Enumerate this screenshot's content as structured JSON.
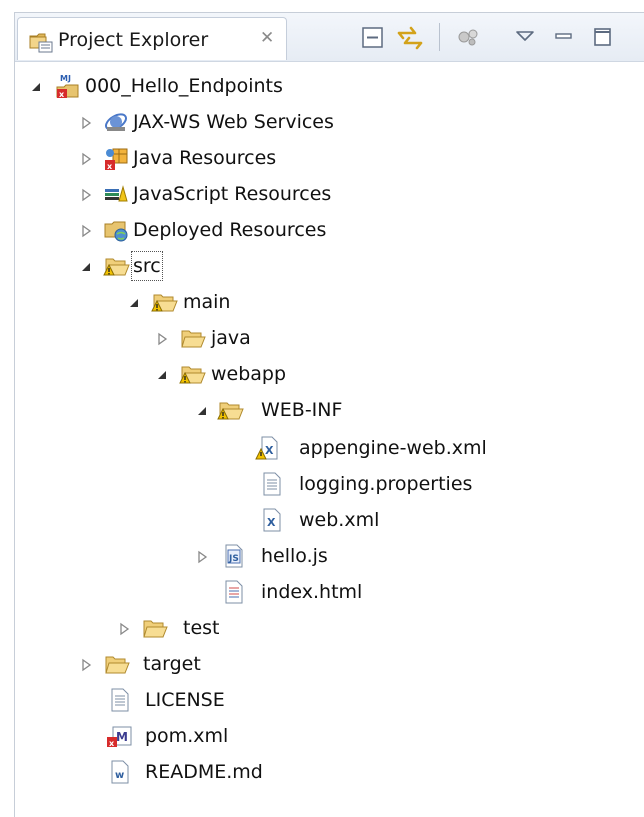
{
  "view": {
    "title": "Project Explorer",
    "close_glyph": "✕"
  },
  "toolbar": {
    "buttons": [
      "collapse-all-icon",
      "link-with-editor-icon",
      "filters-icon",
      "view-menu-icon",
      "minimize-icon",
      "maximize-icon"
    ]
  },
  "tree": {
    "items": [
      {
        "label": "000_Hello_Endpoints",
        "icon": "maven-project-icon",
        "state": "expanded"
      },
      {
        "label": "JAX-WS Web Services",
        "icon": "web-services-icon",
        "state": "collapsed"
      },
      {
        "label": "Java Resources",
        "icon": "java-resources-icon",
        "state": "collapsed"
      },
      {
        "label": "JavaScript Resources",
        "icon": "javascript-resources-icon",
        "state": "collapsed"
      },
      {
        "label": "Deployed Resources",
        "icon": "deployed-resources-icon",
        "state": "collapsed"
      },
      {
        "label": "src",
        "icon": "folder-warning-icon",
        "state": "expanded",
        "focused": true
      },
      {
        "label": "main",
        "icon": "folder-warning-icon",
        "state": "expanded"
      },
      {
        "label": "java",
        "icon": "folder-icon",
        "state": "collapsed"
      },
      {
        "label": "webapp",
        "icon": "folder-warning-icon",
        "state": "expanded"
      },
      {
        "label": "WEB-INF",
        "icon": "folder-warning-icon",
        "state": "expanded"
      },
      {
        "label": "appengine-web.xml",
        "icon": "xml-file-warning-icon",
        "state": "leaf"
      },
      {
        "label": "logging.properties",
        "icon": "text-file-icon",
        "state": "leaf"
      },
      {
        "label": "web.xml",
        "icon": "xml-file-icon",
        "state": "leaf"
      },
      {
        "label": "hello.js",
        "icon": "js-file-icon",
        "state": "collapsed"
      },
      {
        "label": "index.html",
        "icon": "html-file-icon",
        "state": "leaf"
      },
      {
        "label": "test",
        "icon": "folder-icon",
        "state": "collapsed"
      },
      {
        "label": "target",
        "icon": "folder-icon",
        "state": "collapsed"
      },
      {
        "label": "LICENSE",
        "icon": "text-file-icon",
        "state": "leaf"
      },
      {
        "label": "pom.xml",
        "icon": "maven-pom-icon",
        "state": "leaf"
      },
      {
        "label": "README.md",
        "icon": "wiki-file-icon",
        "state": "leaf"
      }
    ]
  }
}
